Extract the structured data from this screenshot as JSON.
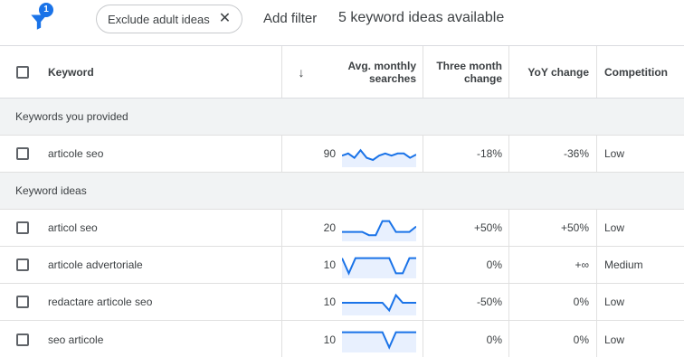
{
  "filter": {
    "badge": "1"
  },
  "chip": {
    "label": "Exclude adult ideas"
  },
  "add_filter": "Add filter",
  "ideas_count": "5 keyword ideas available",
  "columns": {
    "keyword": "Keyword",
    "avg_line1": "Avg. monthly",
    "avg_line2": "searches",
    "three_line1": "Three month",
    "three_line2": "change",
    "yoy": "YoY change",
    "competition": "Competition"
  },
  "groups": {
    "provided": "Keywords you provided",
    "ideas": "Keyword ideas"
  },
  "rows": [
    {
      "keyword": "articole seo",
      "searches": "90",
      "three_month": "-18%",
      "yoy": "-36%",
      "competition": "Low",
      "trend": [
        0.45,
        0.55,
        0.35,
        0.7,
        0.35,
        0.25,
        0.45,
        0.55,
        0.45,
        0.55,
        0.55,
        0.35,
        0.5
      ]
    },
    {
      "keyword": "articol seo",
      "searches": "20",
      "three_month": "+50%",
      "yoy": "+50%",
      "competition": "Low",
      "trend": [
        0.35,
        0.35,
        0.35,
        0.35,
        0.2,
        0.2,
        0.85,
        0.85,
        0.35,
        0.35,
        0.35,
        0.6
      ]
    },
    {
      "keyword": "articole advertoriale",
      "searches": "10",
      "three_month": "0%",
      "yoy": "+∞",
      "competition": "Medium",
      "trend": [
        0.85,
        0.15,
        0.85,
        0.85,
        0.85,
        0.85,
        0.85,
        0.85,
        0.15,
        0.15,
        0.85,
        0.85
      ]
    },
    {
      "keyword": "redactare articole seo",
      "searches": "10",
      "three_month": "-50%",
      "yoy": "0%",
      "competition": "Low",
      "trend": [
        0.5,
        0.5,
        0.5,
        0.5,
        0.5,
        0.5,
        0.5,
        0.15,
        0.85,
        0.5,
        0.5,
        0.5
      ]
    },
    {
      "keyword": "seo articole",
      "searches": "10",
      "three_month": "0%",
      "yoy": "0%",
      "competition": "Low",
      "trend": [
        0.85,
        0.85,
        0.85,
        0.85,
        0.85,
        0.85,
        0.85,
        0.15,
        0.85,
        0.85,
        0.85,
        0.85
      ]
    }
  ],
  "colors": {
    "accent": "#1a73e8",
    "spark_fill": "#e8f0fe"
  }
}
